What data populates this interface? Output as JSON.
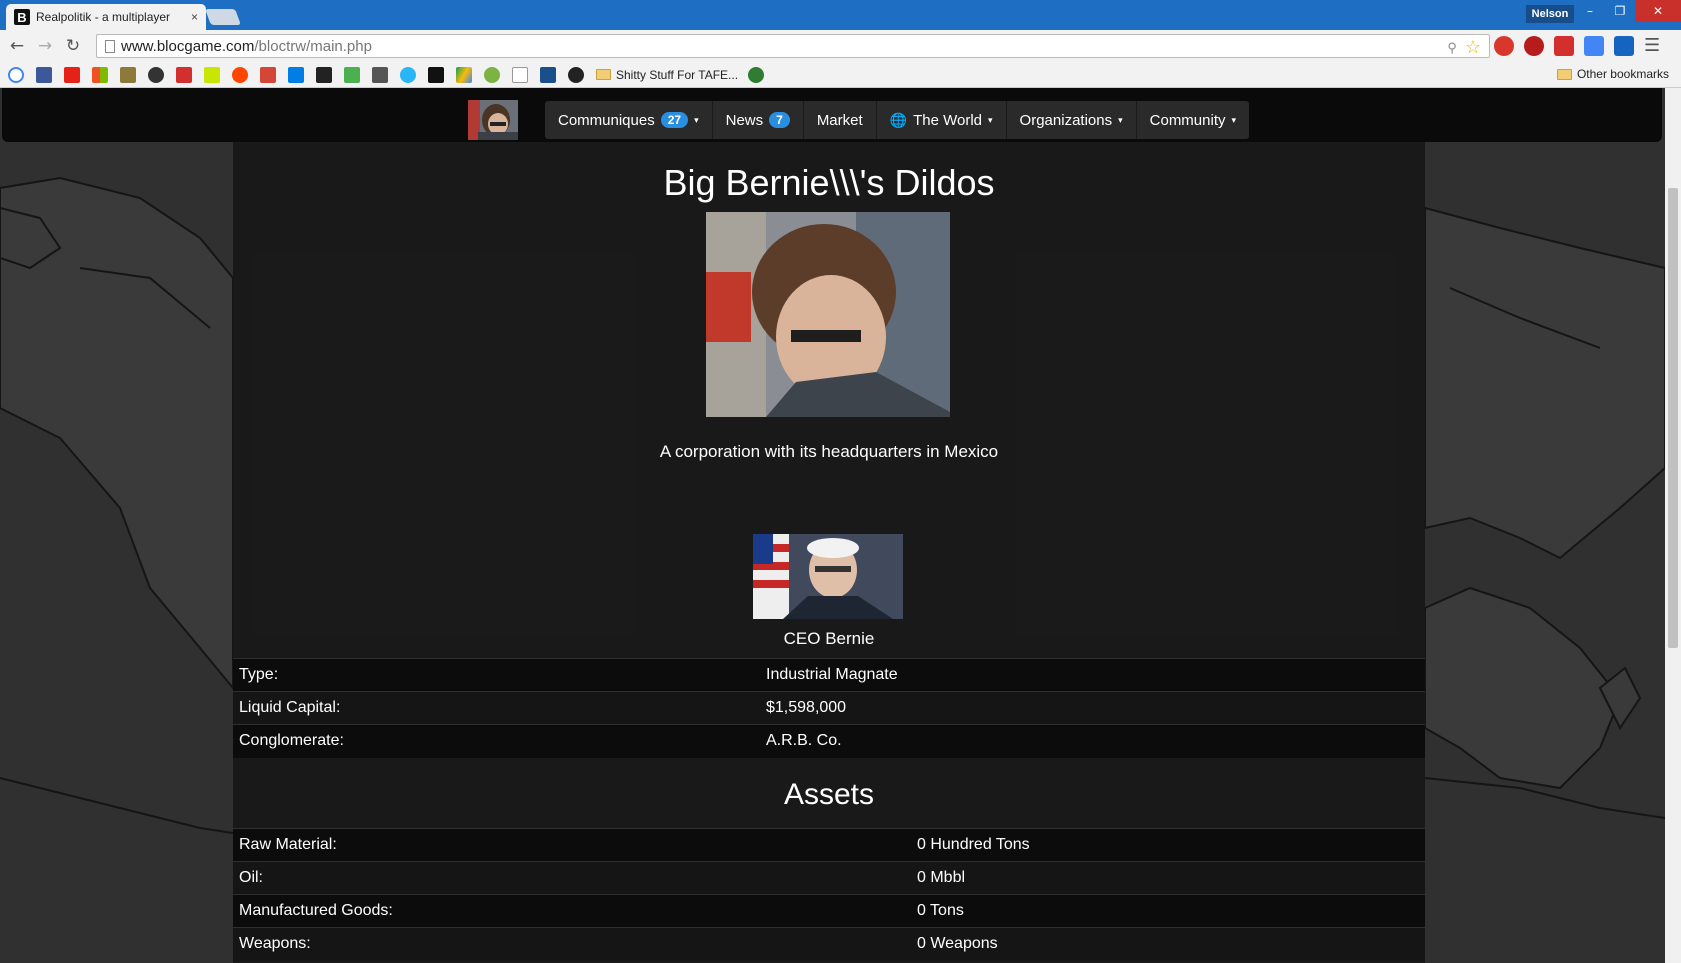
{
  "browser": {
    "tab_title": "Realpolitik - a multiplayer",
    "tab_close": "×",
    "favicon_letter": "B",
    "profile_name": "Nelson",
    "url_host": "www.blocgame.com",
    "url_path": "/bloctrw/main.php",
    "bookmark_folder": "Shitty Stuff For TAFE...",
    "other_bookmarks": "Other bookmarks"
  },
  "nav": {
    "items": [
      {
        "label": "Communiques",
        "badge": "27",
        "caret": "▾"
      },
      {
        "label": "News",
        "badge": "7"
      },
      {
        "label": "Market"
      },
      {
        "label": "The World",
        "caret": "▾"
      },
      {
        "label": "Organizations",
        "caret": "▾"
      },
      {
        "label": "Community",
        "caret": "▾"
      }
    ]
  },
  "page": {
    "title": "Big Bernie\\\\\\'s Dildos",
    "description": "A corporation with its headquarters in Mexico",
    "ceo_name": "CEO Bernie"
  },
  "info": [
    {
      "label": "Type:",
      "value": "Industrial Magnate"
    },
    {
      "label": "Liquid Capital:",
      "value": "$1,598,000"
    },
    {
      "label": "Conglomerate:",
      "value": "A.R.B. Co."
    }
  ],
  "assets": {
    "title": "Assets",
    "rows": [
      {
        "label": "Raw Material:",
        "value": "0 Hundred Tons"
      },
      {
        "label": "Oil:",
        "value": "0 Mbbl"
      },
      {
        "label": "Manufactured Goods:",
        "value": "0 Tons"
      },
      {
        "label": "Weapons:",
        "value": "0 Weapons"
      }
    ]
  }
}
